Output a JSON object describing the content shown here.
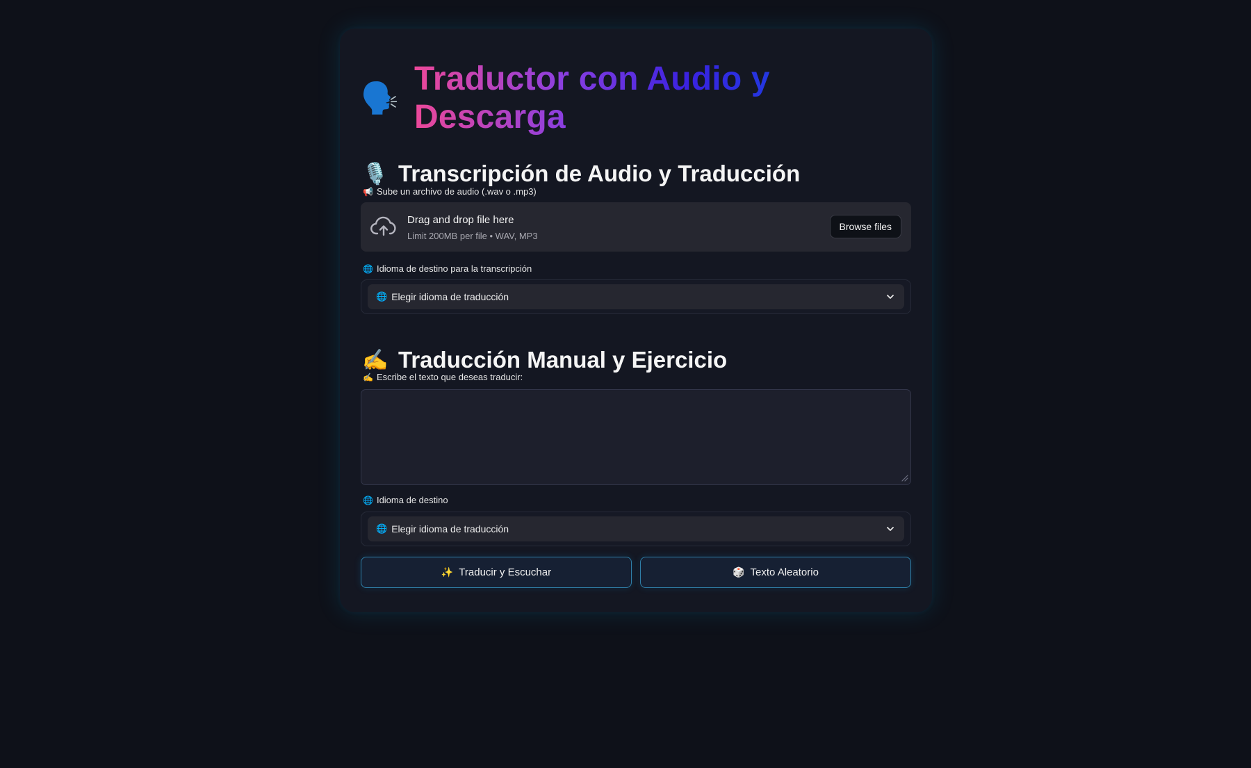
{
  "header": {
    "title_icon": "🗣️",
    "title": "Traductor con Audio y Descarga"
  },
  "audio_section": {
    "icon": "🎙️",
    "heading": "Transcripción de Audio y Traducción",
    "upload_label_icon": "📢",
    "upload_label": "Sube un archivo de audio (.wav o .mp3)",
    "uploader": {
      "icon": "cloud-upload-icon",
      "primary_text": "Drag and drop file here",
      "secondary_text": "Limit 200MB per file • WAV, MP3",
      "browse_label": "Browse files"
    },
    "language_label_icon": "🌐",
    "language_label": "Idioma de destino para la transcripción",
    "language_select": {
      "icon": "🌐",
      "value": "Elegir idioma de traducción"
    }
  },
  "manual_section": {
    "icon": "✍️",
    "heading": "Traducción Manual y Ejercicio",
    "text_label_icon": "✍️",
    "text_label": "Escribe el texto que deseas traducir:",
    "text_value": "",
    "language_label_icon": "🌐",
    "language_label": "Idioma de destino",
    "language_select": {
      "icon": "🌐",
      "value": "Elegir idioma de traducción"
    }
  },
  "actions": {
    "translate_icon": "✨",
    "translate_label": "Traducir y Escuchar",
    "random_icon": "🎲",
    "random_label": "Texto Aleatorio"
  },
  "colors": {
    "background": "#0e1119",
    "card": "#141722",
    "input": "#262730",
    "accent_border": "#2f7fa8",
    "title_gradient": [
      "#ec4899",
      "#8b3fe0",
      "#3a22e0",
      "#1a3fe0",
      "#06a6e0"
    ]
  }
}
